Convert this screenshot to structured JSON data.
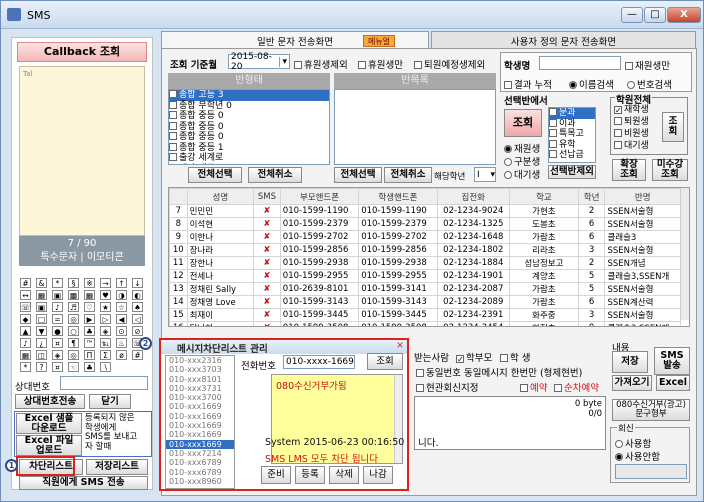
{
  "window": {
    "title": "SMS",
    "min": "—",
    "max": "□",
    "close": "X"
  },
  "phone": {
    "callback_label": "Callback 조회",
    "screen_header": "Tal",
    "counter": "7 / 90",
    "special_label": "특수문자 | 이모티콘",
    "sender_label": "상대번호",
    "sender_send": "상대번호전송",
    "close_btn": "닫기",
    "excel_sample": "Excel 샘플\n다운로드",
    "excel_upload": "Excel 파일\n업로드",
    "unregistered_note": "등록되지 않은\n학생에게\nSMS를 보내고\n자 할때",
    "block_list": "차단리스트",
    "save_list": "저장리스트",
    "staff_sms": "직원에게 SMS 전송",
    "symbols": [
      "#",
      "&",
      "*",
      "§",
      "※",
      "→",
      "↑",
      "↓",
      "↔",
      "▦",
      "▣",
      "▩",
      "▦",
      "♥",
      "◑",
      "◐",
      "☏",
      "▣",
      "♪",
      "♬",
      "♡",
      "★",
      "☆",
      "♠",
      "◆",
      "□",
      "=",
      "◎",
      "▶",
      "▷",
      "◀",
      "◁",
      "▲",
      "▼",
      "●",
      "○",
      "♣",
      "◈",
      "⊙",
      "⊘",
      "♪",
      "¿",
      "¤",
      "¶",
      "™",
      "℡",
      "♨",
      "☏",
      "▦",
      "◫",
      "◈",
      "◎",
      "Π",
      "Σ",
      "ø",
      "#",
      "*",
      "?",
      "¤",
      "☜",
      "♣",
      "∖"
    ]
  },
  "tabs": {
    "main": "일반 문자 전송화면",
    "menu_badge": "메뉴얼",
    "custom": "사용자 정의 문자 전송화면"
  },
  "filter": {
    "base_month_label": "조회 기준월",
    "base_month": "2015-08-20",
    "exclude_leave": "휴원생제외",
    "leave_only": "휴원생만",
    "exclude_expected": "퇴원예정생제외",
    "student_name_label": "학생명",
    "enrolled_only": "재원생만",
    "result_cumulative": "결과 누적",
    "sort_name": "이름검색",
    "sort_number": "번호검색"
  },
  "left_list": {
    "header": "반형태",
    "items": [
      "종합 고등 3",
      "종합 무학년 0",
      "종합 중등 0",
      "종합 중등 0",
      "종합 중등 0",
      "종합 중등 1",
      "출강 세계로",
      "캐나 밴쿠 2"
    ]
  },
  "right_list": {
    "header": "반목록"
  },
  "selection": {
    "title": "선택반에서",
    "query": "조회",
    "enrolled": "재원생",
    "graduated": "구분생",
    "waiting": "대기생",
    "subjects": [
      "문과",
      "이과",
      "특목고",
      "유학",
      "선납금"
    ],
    "exclude_selected": "선택반제외"
  },
  "academy": {
    "title": "학원전체",
    "items": [
      "재학생",
      "퇴원생",
      "비원생",
      "대기생"
    ],
    "query": "조\n회",
    "expand": "확장\n조회",
    "unpaid": "미수강\n조회"
  },
  "list_buttons": {
    "select_all": "전체선택",
    "deselect_all": "전체취소",
    "grade_label": "해당학년",
    "grade_value": "I"
  },
  "grid": {
    "headers": [
      "성명",
      "SMS",
      "부모핸드폰",
      "학생핸드폰",
      "집전화",
      "학교",
      "학년",
      "반명"
    ],
    "rows": [
      [
        "7",
        "민민민",
        "✘",
        "010-1599-1190",
        "010-1599-1190",
        "02-1234-9024",
        "가현초",
        "2",
        "SSEN서술형"
      ],
      [
        "8",
        "이석현",
        "✘",
        "010-1599-2379",
        "010-1599-2379",
        "02-1234-1325",
        "도봉초",
        "6",
        "SSEN서술형"
      ],
      [
        "9",
        "이한나",
        "✘",
        "010-1599-2702",
        "010-1599-2702",
        "02-1234-1648",
        "가람초",
        "6",
        "클래슬3"
      ],
      [
        "10",
        "장나라",
        "✘",
        "010-1599-2856",
        "010-1599-2856",
        "02-1234-1802",
        "리라초",
        "3",
        "SSEN서술형"
      ],
      [
        "11",
        "장한나",
        "✘",
        "010-1599-2938",
        "010-1599-2938",
        "02-1234-1884",
        "성남정보고",
        "2",
        "SSEN개념"
      ],
      [
        "12",
        "전세나",
        "✘",
        "010-1599-2955",
        "010-1599-2955",
        "02-1234-1901",
        "계양초",
        "5",
        "클래슬3,SSEN개"
      ],
      [
        "13",
        "정채린 Sally",
        "✘",
        "010-2639-8101",
        "010-1599-3141",
        "02-1234-2087",
        "가람초",
        "5",
        "SSEN서술형"
      ],
      [
        "14",
        "정채영 Love",
        "✘",
        "010-1599-3143",
        "010-1599-3143",
        "02-1234-2089",
        "가람초",
        "6",
        "SSEN계산력"
      ],
      [
        "15",
        "최재이",
        "✘",
        "010-1599-3445",
        "010-1599-3445",
        "02-1234-2391",
        "화주중",
        "3",
        "SSEN서술형"
      ],
      [
        "16",
        "탁나현",
        "✘",
        "010-1599-3508",
        "010-1599-3508",
        "02-1234-2454",
        "한정초",
        "0",
        "클래슬3,SSEN개"
      ]
    ]
  },
  "send": {
    "recipients_label": "받는사람",
    "parent": "학부모",
    "student": "학  생",
    "same_number": "동일번호 동일메시지 한번만 (형제현번)",
    "home_block": "현관회신지정",
    "reserve": "예약",
    "sequence": "순차예약",
    "content_label": "내용",
    "save": "저장",
    "sms_send": "SMS\n발송",
    "load": "가져오기",
    "excel": "Excel",
    "byte_count": "0 byte",
    "byte_ratio": "0/0",
    "unsubscribe": "080수신거부(광고)\n문구형부",
    "reply_title": "회신",
    "use": "사용함",
    "not_use": "사용안함",
    "note": "니다."
  },
  "blocklist": {
    "title": "메시지차단리스트 관리",
    "phone_label": "전화번호",
    "phone_value": "010-xxxx-1669",
    "search": "조회",
    "numbers": [
      "010-xxx2316",
      "010-xxx3703",
      "010-xxx8101",
      "010-xxx3731",
      "010-xxx3700",
      "010-xxx1669",
      "010-xxx1669",
      "010-xxx1669",
      "010-xxx1669",
      "010-xxx1669",
      "010-xxx7214",
      "010-xxx6789",
      "010-xxx6789",
      "010-xxx8960"
    ],
    "selected_index": 9,
    "message": "080수신거부가됨",
    "system_line": "System 2015-06-23 00:16:50",
    "block_notice": "SMS LMS 모두 차단 됩니다",
    "buttons": [
      "준비",
      "등록",
      "삭제",
      "나감"
    ]
  },
  "markers": {
    "one": "1",
    "two": "2"
  },
  "colors": {
    "accent_red": "#e0201a",
    "header_gray": "#a9a9a9",
    "badge_orange": "#f6a83c"
  }
}
